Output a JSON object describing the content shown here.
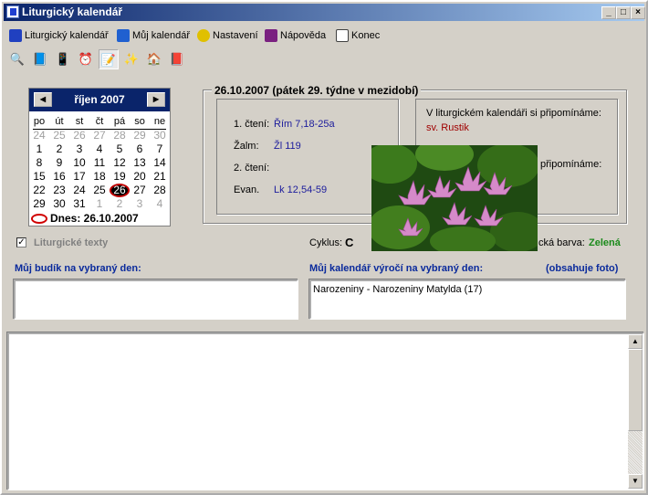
{
  "window": {
    "title": "Liturgický kalendář"
  },
  "menu": [
    {
      "label": "Liturgický kalendář",
      "icon": "book-icon",
      "color": "#2040c0"
    },
    {
      "label": "Můj kalendář",
      "icon": "notebook-icon",
      "color": "#2060d0"
    },
    {
      "label": "Nastavení",
      "icon": "face-icon",
      "color": "#e0c000"
    },
    {
      "label": "Nápověda",
      "icon": "help-book-icon",
      "color": "#7a2080"
    },
    {
      "label": "Konec",
      "icon": "exit-door-icon",
      "color": "#404040"
    }
  ],
  "toolbar": [
    {
      "icon": "magnifier-icon",
      "glyph": "🔍"
    },
    {
      "icon": "book-icon",
      "glyph": "📘"
    },
    {
      "icon": "phone-icon",
      "glyph": "📱"
    },
    {
      "icon": "clock-icon",
      "glyph": "⏰"
    },
    {
      "icon": "calendar-edit-icon",
      "glyph": "📝"
    },
    {
      "icon": "wand-icon",
      "glyph": "✨"
    },
    {
      "icon": "home-icon",
      "glyph": "🏠"
    },
    {
      "icon": "library-book-icon",
      "glyph": "📕"
    }
  ],
  "calendar": {
    "month_label": "říjen 2007",
    "prev": "◀",
    "next": "▶",
    "weekdays": [
      "po",
      "út",
      "st",
      "čt",
      "pá",
      "so",
      "ne"
    ],
    "weeks": [
      [
        {
          "d": "24",
          "dim": true
        },
        {
          "d": "25",
          "dim": true
        },
        {
          "d": "26",
          "dim": true
        },
        {
          "d": "27",
          "dim": true
        },
        {
          "d": "28",
          "dim": true
        },
        {
          "d": "29",
          "dim": true
        },
        {
          "d": "30",
          "dim": true
        }
      ],
      [
        {
          "d": "1"
        },
        {
          "d": "2"
        },
        {
          "d": "3"
        },
        {
          "d": "4"
        },
        {
          "d": "5"
        },
        {
          "d": "6"
        },
        {
          "d": "7"
        }
      ],
      [
        {
          "d": "8"
        },
        {
          "d": "9"
        },
        {
          "d": "10"
        },
        {
          "d": "11"
        },
        {
          "d": "12"
        },
        {
          "d": "13"
        },
        {
          "d": "14"
        }
      ],
      [
        {
          "d": "15"
        },
        {
          "d": "16"
        },
        {
          "d": "17"
        },
        {
          "d": "18"
        },
        {
          "d": "19"
        },
        {
          "d": "20"
        },
        {
          "d": "21"
        }
      ],
      [
        {
          "d": "22"
        },
        {
          "d": "23"
        },
        {
          "d": "24"
        },
        {
          "d": "25"
        },
        {
          "d": "26",
          "sel": true
        },
        {
          "d": "27"
        },
        {
          "d": "28"
        }
      ],
      [
        {
          "d": "29"
        },
        {
          "d": "30"
        },
        {
          "d": "31"
        },
        {
          "d": "1",
          "dim": true
        },
        {
          "d": "2",
          "dim": true
        },
        {
          "d": "3",
          "dim": true
        },
        {
          "d": "4",
          "dim": true
        }
      ]
    ],
    "today_label": "Dnes: 26.10.2007"
  },
  "day": {
    "heading": "26.10.2007 (pátek 29. týdne v mezidobí)",
    "readings": [
      {
        "label": "1. čtení:",
        "value": "Řím 7,18-25a"
      },
      {
        "label": "Žalm:",
        "value": "Žl 119"
      },
      {
        "label": "2. čtení:",
        "value": ""
      },
      {
        "label": "Evan.",
        "value": "Lk 12,54-59"
      }
    ],
    "commem_heading": "V liturgickém kalendáři si připomínáme:",
    "commem_value": "sv. Rustik",
    "commem_heading_2": "připomínáme:",
    "cycle_label": "Cyklus:",
    "cycle_value": "C",
    "color_label": "cká barva:",
    "color_value": "Zelená"
  },
  "checkbox_label": "Liturgické texty",
  "alarm_label": "Můj budík na vybraný den:",
  "anniv_label": "Můj kalendář výročí na vybraný den:",
  "photo_note": "(obsahuje foto)",
  "anniv_text": "Narozeniny - Narozeniny Matylda (17)"
}
